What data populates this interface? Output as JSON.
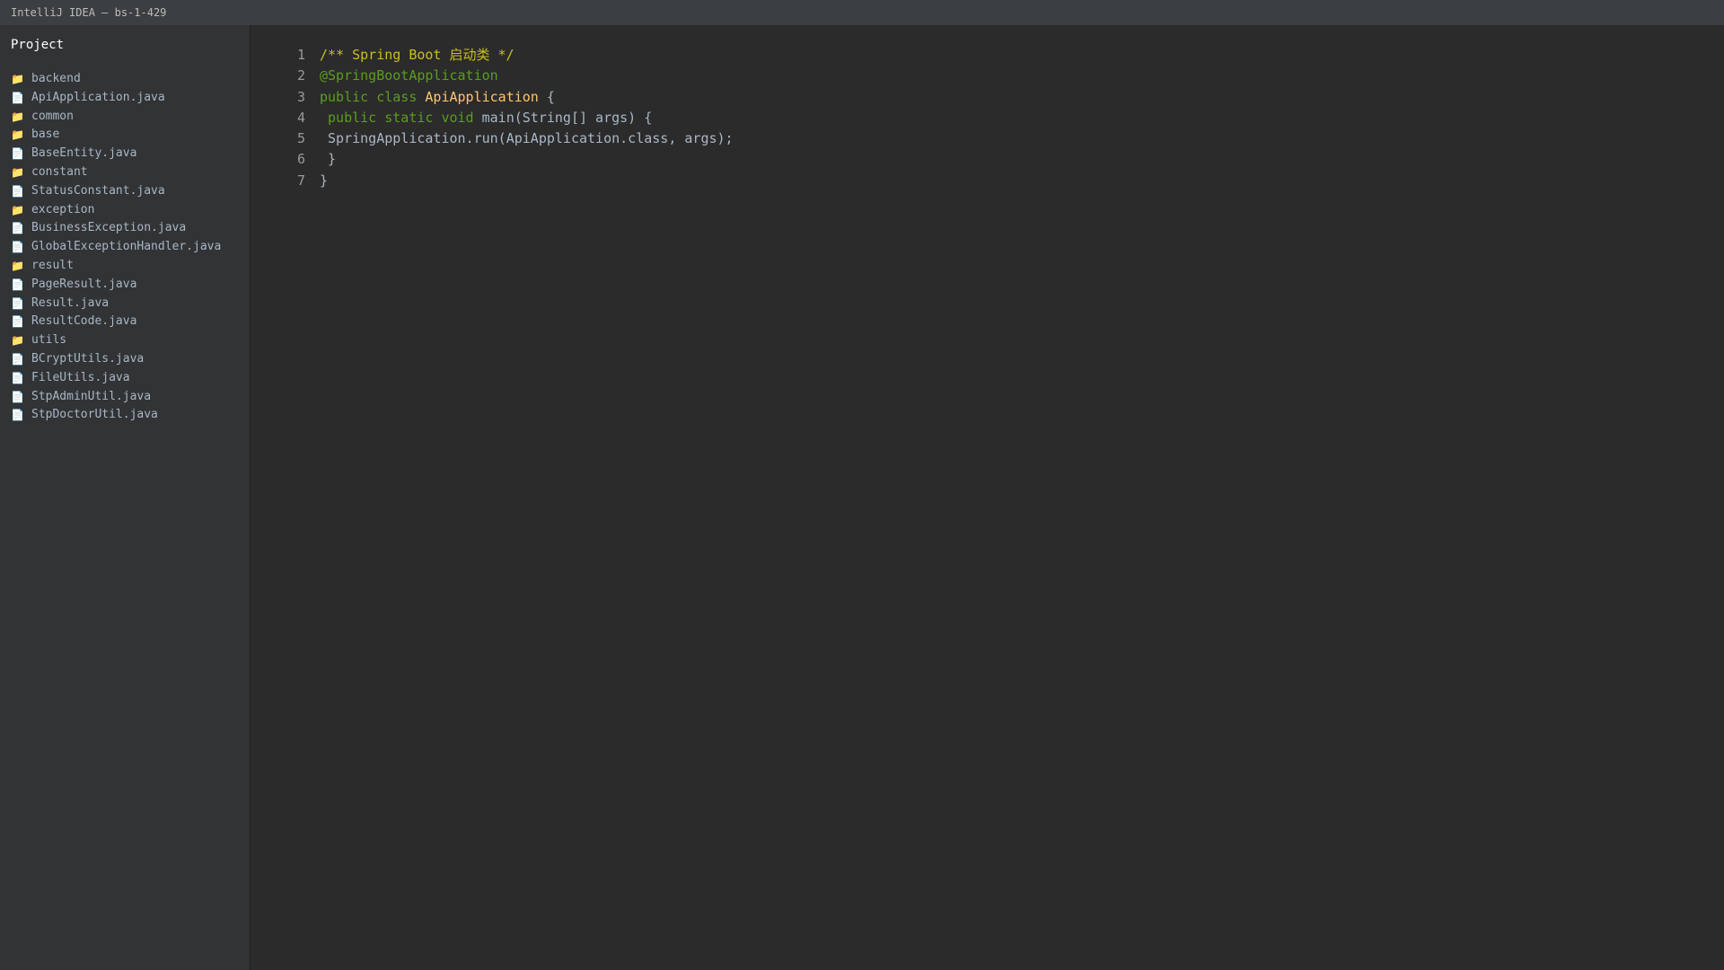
{
  "window": {
    "title": "IntelliJ IDEA — bs-1-429"
  },
  "sidebar": {
    "title": "Project",
    "items": [
      {
        "type": "folder",
        "icon": "folder-icon",
        "label": "backend"
      },
      {
        "type": "file",
        "icon": "file-icon",
        "label": "ApiApplication.java"
      },
      {
        "type": "folder",
        "icon": "folder-icon",
        "label": "common"
      },
      {
        "type": "folder",
        "icon": "folder-icon",
        "label": "base"
      },
      {
        "type": "file",
        "icon": "file-icon",
        "label": "BaseEntity.java"
      },
      {
        "type": "folder",
        "icon": "folder-icon",
        "label": "constant"
      },
      {
        "type": "file",
        "icon": "file-icon",
        "label": "StatusConstant.java"
      },
      {
        "type": "folder",
        "icon": "folder-icon",
        "label": "exception"
      },
      {
        "type": "file",
        "icon": "file-icon",
        "label": "BusinessException.java"
      },
      {
        "type": "file",
        "icon": "file-icon",
        "label": "GlobalExceptionHandler.java"
      },
      {
        "type": "folder",
        "icon": "folder-icon",
        "label": "result"
      },
      {
        "type": "file",
        "icon": "file-icon",
        "label": "PageResult.java"
      },
      {
        "type": "file",
        "icon": "file-icon",
        "label": "Result.java"
      },
      {
        "type": "file",
        "icon": "file-icon",
        "label": "ResultCode.java"
      },
      {
        "type": "folder",
        "icon": "folder-icon",
        "label": "utils"
      },
      {
        "type": "file",
        "icon": "file-icon",
        "label": "BCryptUtils.java"
      },
      {
        "type": "file",
        "icon": "file-icon",
        "label": "FileUtils.java"
      },
      {
        "type": "file",
        "icon": "file-icon",
        "label": "StpAdminUtil.java"
      },
      {
        "type": "file",
        "icon": "file-icon",
        "label": "StpDoctorUtil.java"
      }
    ]
  },
  "editor": {
    "lines": [
      {
        "number": "1",
        "tokens": [
          {
            "kind": "comment",
            "text": "/** Spring Boot 启动类 */"
          }
        ]
      },
      {
        "number": "2",
        "tokens": [
          {
            "kind": "annotation",
            "text": "@SpringBootApplication"
          }
        ]
      },
      {
        "number": "3",
        "tokens": [
          {
            "kind": "keyword",
            "text": "public class "
          },
          {
            "kind": "classname",
            "text": "ApiApplication"
          },
          {
            "kind": "plain",
            "text": " {"
          }
        ]
      },
      {
        "number": "4",
        "tokens": [
          {
            "kind": "plain",
            "text": " "
          },
          {
            "kind": "keyword",
            "text": "public static void "
          },
          {
            "kind": "plain",
            "text": "main(String[] args) {"
          }
        ]
      },
      {
        "number": "5",
        "tokens": [
          {
            "kind": "plain",
            "text": " SpringApplication.run(ApiApplication.class, args);"
          }
        ]
      },
      {
        "number": "6",
        "tokens": [
          {
            "kind": "plain",
            "text": " }"
          }
        ]
      },
      {
        "number": "7",
        "tokens": [
          {
            "kind": "plain",
            "text": "}"
          }
        ]
      }
    ]
  },
  "colors": {
    "background": "#2b2b2b",
    "sidebar": "#313335",
    "titlebar": "#3c3f41",
    "comment": "#c8c01a",
    "keyword": "#5a9e1e",
    "classname": "#ffc66d",
    "text": "#a9b7c6",
    "folder": "#e2b85a"
  }
}
